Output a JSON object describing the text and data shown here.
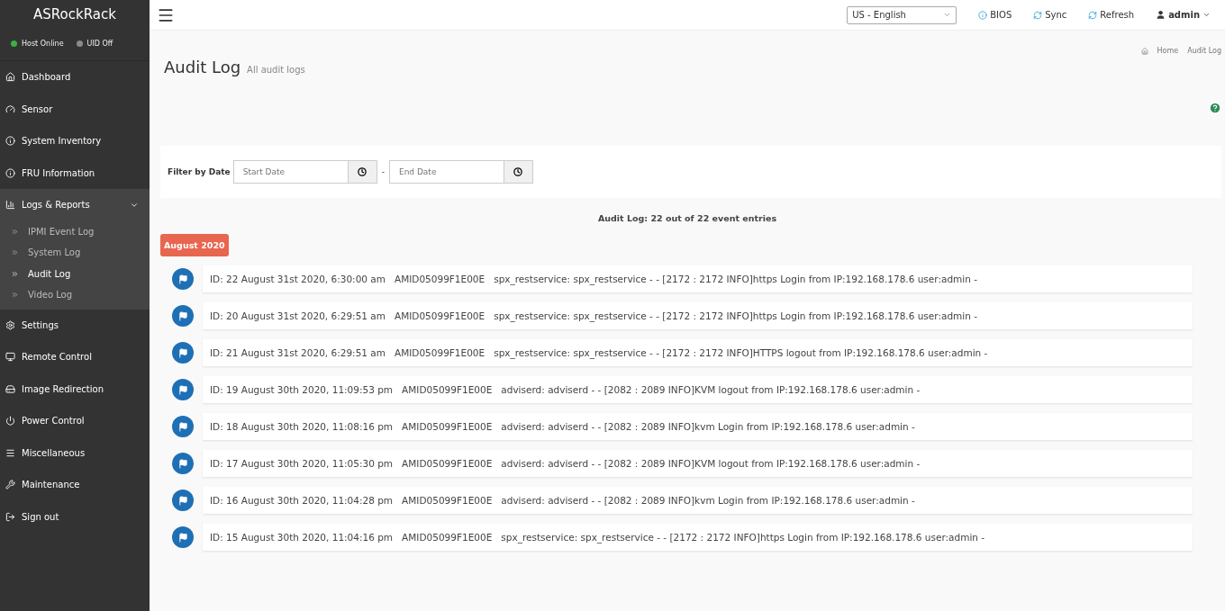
{
  "sidebar": {
    "brand": "ASRockRack",
    "indicators": [
      {
        "label": "Host Online",
        "color": "#3cb043"
      },
      {
        "label": "UID Off",
        "color": "#8a8a8a"
      }
    ],
    "items": [
      {
        "label": "Dashboard"
      },
      {
        "label": "Sensor"
      },
      {
        "label": "System Inventory"
      },
      {
        "label": "FRU Information"
      },
      {
        "label": "Logs & Reports",
        "expanded": true,
        "children": [
          {
            "label": "IPMI Event Log",
            "selected": false
          },
          {
            "label": "System Log",
            "selected": false
          },
          {
            "label": "Audit Log",
            "selected": true
          },
          {
            "label": "Video Log",
            "selected": false
          }
        ]
      },
      {
        "label": "Settings"
      },
      {
        "label": "Remote Control"
      },
      {
        "label": "Image Redirection"
      },
      {
        "label": "Power Control"
      },
      {
        "label": "Miscellaneous"
      },
      {
        "label": "Maintenance"
      },
      {
        "label": "Sign out"
      }
    ]
  },
  "topbar": {
    "language": "US - English",
    "links": [
      "BIOS",
      "Sync",
      "Refresh"
    ],
    "user": "admin"
  },
  "page": {
    "title": "Audit Log",
    "subtitle": "All audit logs",
    "breadcrumb": [
      "Home",
      "Audit Log"
    ]
  },
  "filter": {
    "label": "Filter by Date",
    "start": {
      "placeholder": "Start Date"
    },
    "separator": "-",
    "end": {
      "placeholder": "End Date"
    }
  },
  "summary": "Audit Log: 22 out of 22 event entries",
  "month": "August 2020",
  "entries": [
    {
      "id": "ID: 22 August 31st 2020, 6:30:00 am",
      "host": "AMID05099F1E00E",
      "message": "spx_restservice: spx_restservice - - [2172 : 2172 INFO]https Login from IP:192.168.178.6 user:admin -"
    },
    {
      "id": "ID: 20 August 31st 2020, 6:29:51 am",
      "host": "AMID05099F1E00E",
      "message": "spx_restservice: spx_restservice - - [2172 : 2172 INFO]https Login from IP:192.168.178.6 user:admin -"
    },
    {
      "id": "ID: 21 August 31st 2020, 6:29:51 am",
      "host": "AMID05099F1E00E",
      "message": "spx_restservice: spx_restservice - - [2172 : 2172 INFO]HTTPS logout from IP:192.168.178.6 user:admin -"
    },
    {
      "id": "ID: 19 August 30th 2020, 11:09:53 pm",
      "host": "AMID05099F1E00E",
      "message": "adviserd: adviserd - - [2082 : 2089 INFO]KVM logout from IP:192.168.178.6 user:admin -"
    },
    {
      "id": "ID: 18 August 30th 2020, 11:08:16 pm",
      "host": "AMID05099F1E00E",
      "message": "adviserd: adviserd - - [2082 : 2089 INFO]kvm Login from IP:192.168.178.6 user:admin -"
    },
    {
      "id": "ID: 17 August 30th 2020, 11:05:30 pm",
      "host": "AMID05099F1E00E",
      "message": "adviserd: adviserd - - [2082 : 2089 INFO]KVM logout from IP:192.168.178.6 user:admin -"
    },
    {
      "id": "ID: 16 August 30th 2020, 11:04:28 pm",
      "host": "AMID05099F1E00E",
      "message": "adviserd: adviserd - - [2082 : 2089 INFO]kvm Login from IP:192.168.178.6 user:admin -"
    },
    {
      "id": "ID: 15 August 30th 2020, 11:04:16 pm",
      "host": "AMID05099F1E00E",
      "message": "spx_restservice: spx_restservice - - [2172 : 2172 INFO]https Login from IP:192.168.178.6 user:admin -"
    }
  ]
}
